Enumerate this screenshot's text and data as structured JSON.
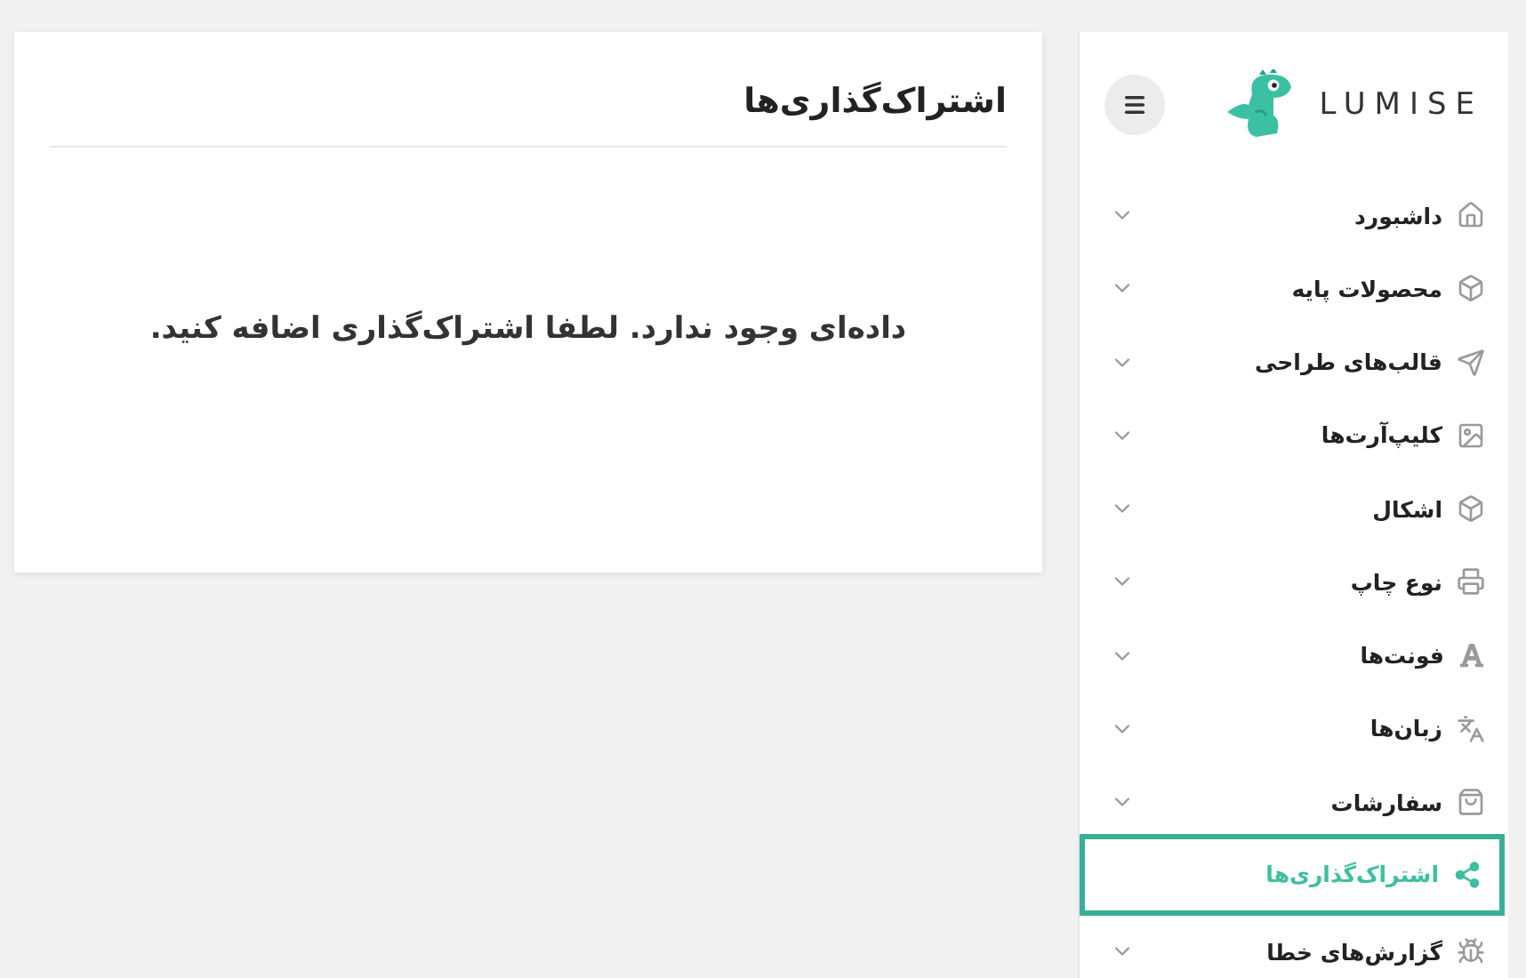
{
  "main": {
    "title": "اشتراک‌گذاری‌ها",
    "empty_message": "داده‌ای وجود ندارد. لطفا اشتراک‌گذاری اضافه کنید."
  },
  "sidebar": {
    "logo_text": "LUMISE",
    "items": [
      {
        "label": "داشبورد",
        "selected": false,
        "has_submenu": true
      },
      {
        "label": "محصولات پایه",
        "selected": false,
        "has_submenu": true
      },
      {
        "label": "قالب‌های طراحی",
        "selected": false,
        "has_submenu": true
      },
      {
        "label": "کلیپ‌آرت‌ها",
        "selected": false,
        "has_submenu": true
      },
      {
        "label": "اشکال",
        "selected": false,
        "has_submenu": true
      },
      {
        "label": "نوع چاپ",
        "selected": false,
        "has_submenu": true
      },
      {
        "label": "فونت‌ها",
        "selected": false,
        "has_submenu": true
      },
      {
        "label": "زبان‌ها",
        "selected": false,
        "has_submenu": true
      },
      {
        "label": "سفارشات",
        "selected": false,
        "has_submenu": true
      },
      {
        "label": "اشتراک‌گذاری‌ها",
        "selected": true,
        "has_submenu": false
      },
      {
        "label": "گزارش‌های خطا",
        "selected": false,
        "has_submenu": true
      }
    ]
  }
}
